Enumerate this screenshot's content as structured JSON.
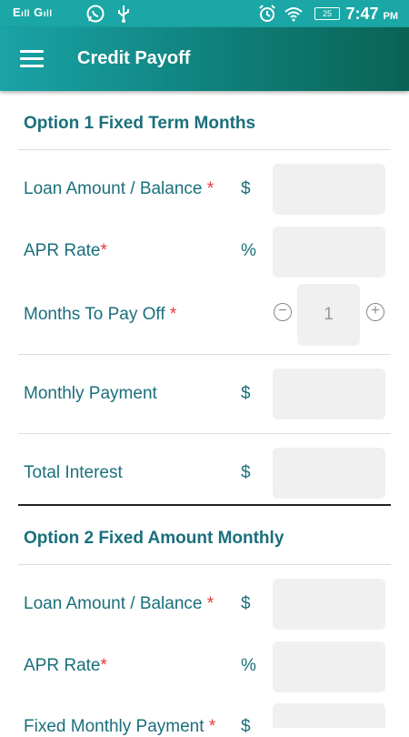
{
  "status_bar": {
    "network1": "E",
    "network2": "G",
    "battery": "25",
    "time": "7:47",
    "ampm": "PM"
  },
  "app_bar": {
    "title": "Credit Payoff"
  },
  "option1": {
    "title": "Option 1 Fixed Term Months",
    "loan_label": "Loan Amount / Balance ",
    "loan_unit": "$",
    "apr_label": "APR Rate",
    "apr_unit": "%",
    "months_label": "Months To Pay Off ",
    "months_value": "1",
    "payment_label": "Monthly Payment",
    "payment_unit": "$",
    "interest_label": "Total Interest",
    "interest_unit": "$"
  },
  "option2": {
    "title": "Option 2 Fixed Amount Monthly",
    "loan_label": "Loan Amount / Balance ",
    "loan_unit": "$",
    "apr_label": "APR Rate",
    "apr_unit": "%",
    "fixed_label": "Fixed Monthly Payment ",
    "fixed_unit": "$"
  },
  "required_mark": "*"
}
